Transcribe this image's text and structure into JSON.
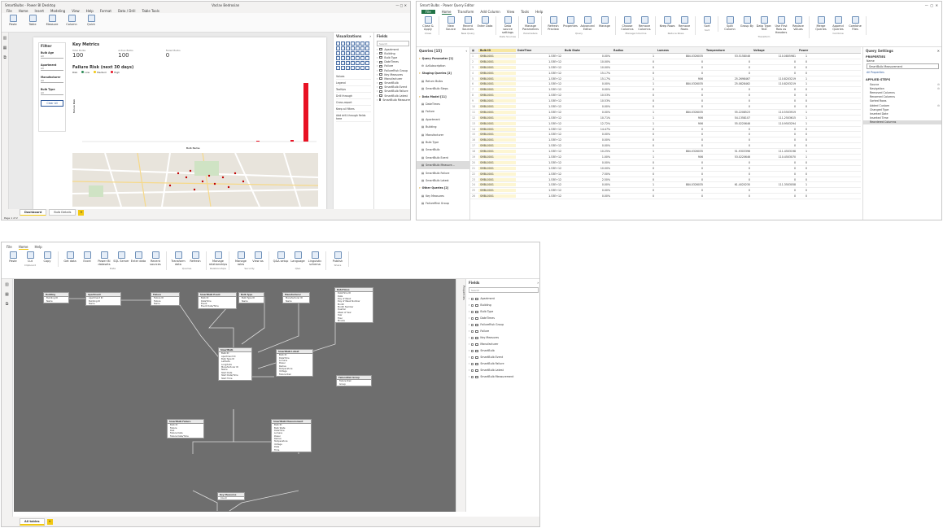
{
  "report": {
    "title": "SmartBulbs - Power BI Desktop",
    "user": "Vaclav Bedrosian",
    "menu": [
      "File",
      "Home",
      "Insert",
      "Modeling",
      "View",
      "Help",
      "Format",
      "Data / Drill",
      "Table Tools"
    ],
    "filter_pane": {
      "title": "Filter",
      "fields": [
        {
          "label": "Bulb Age",
          "value": "All"
        },
        {
          "label": "Apartment",
          "value": "All"
        },
        {
          "label": "Manufacturer",
          "value": "All"
        },
        {
          "label": "Bulb Type",
          "value": "All"
        }
      ],
      "button": "Clear All"
    },
    "card": {
      "title": "Key Metrics",
      "metrics": [
        {
          "label": "Total Bulbs",
          "value": "100"
        },
        {
          "label": "Active Bulbs",
          "value": "100"
        },
        {
          "label": "Failed Bulbs",
          "value": "0"
        }
      ]
    },
    "chart": {
      "title": "Failure Risk (next 30 days)",
      "legend": [
        "Risk",
        "Low",
        "Medium",
        "High"
      ],
      "xlabel": "Bulb Name",
      "ylabel": "Failure Risk"
    },
    "visualizations": {
      "title": "Visualizations",
      "sections": [
        "Values",
        "Legend",
        "Tooltips",
        "Drill through",
        "Cross-report",
        "Keep all filters",
        "Add drill-through fields here"
      ]
    },
    "fields": {
      "title": "Fields",
      "search": "Search",
      "items": [
        "Apartment",
        "Building",
        "Bulb Type",
        "DateTimes",
        "Failure",
        "FailureRisk Group",
        "Key Measures",
        "Manufacturer",
        "SmartBulb",
        "SmartBulb Event",
        "SmartBulb Failure",
        "SmartBulb Latest",
        "SmartBulb Measurement"
      ]
    },
    "pages": [
      "Dashboard",
      "Bulb Details"
    ],
    "status": "Page 1 of 2"
  },
  "query_editor": {
    "title": "Smart Bulbs - Power Query Editor",
    "tabs": [
      "File",
      "Home",
      "Transform",
      "Add Column",
      "View",
      "Tools",
      "Help"
    ],
    "ribbon": [
      {
        "group": "Close",
        "buttons": [
          "Close & Apply"
        ]
      },
      {
        "group": "New Query",
        "buttons": [
          "New Source",
          "Recent Sources",
          "Enter Data"
        ]
      },
      {
        "group": "Data Sources",
        "buttons": [
          "Data source settings"
        ]
      },
      {
        "group": "Parameters",
        "buttons": [
          "Manage Parameters"
        ]
      },
      {
        "group": "Query",
        "buttons": [
          "Refresh Preview",
          "Properties",
          "Advanced Editor",
          "Manage"
        ]
      },
      {
        "group": "Manage Columns",
        "buttons": [
          "Choose Columns",
          "Remove Columns"
        ]
      },
      {
        "group": "Reduce Rows",
        "buttons": [
          "Keep Rows",
          "Remove Rows"
        ]
      },
      {
        "group": "Sort",
        "buttons": [
          "Sort"
        ]
      },
      {
        "group": "Transform",
        "buttons": [
          "Split Column",
          "Group By",
          "Data Type: Text",
          "Use First Row as Headers",
          "Replace Values"
        ]
      },
      {
        "group": "Combine",
        "buttons": [
          "Merge Queries",
          "Append Queries",
          "Combine Files"
        ]
      }
    ],
    "queries_title": "Queries [15]",
    "queries": [
      {
        "name": "Query Parameter [1]",
        "kind": "folder"
      },
      {
        "name": "AzSubscription",
        "kind": "param"
      },
      {
        "name": "Staging Queries [2]",
        "kind": "folder"
      },
      {
        "name": "Return Bulbs",
        "kind": "table"
      },
      {
        "name": "SmartBulb Steps",
        "kind": "table"
      },
      {
        "name": "Data Model [11]",
        "kind": "folder"
      },
      {
        "name": "DateTimes",
        "kind": "table"
      },
      {
        "name": "Failure",
        "kind": "table"
      },
      {
        "name": "Apartment",
        "kind": "table"
      },
      {
        "name": "Building",
        "kind": "table"
      },
      {
        "name": "Manufacturer",
        "kind": "table"
      },
      {
        "name": "Bulb Type",
        "kind": "table"
      },
      {
        "name": "SmartBulb",
        "kind": "table"
      },
      {
        "name": "SmartBulb Event",
        "kind": "table"
      },
      {
        "name": "SmartBulb Measure...",
        "kind": "table",
        "selected": true
      },
      {
        "name": "SmartBulb Failure",
        "kind": "table"
      },
      {
        "name": "SmartBulb Latest",
        "kind": "table"
      },
      {
        "name": "Other Queries [2]",
        "kind": "folder"
      },
      {
        "name": "Key Measures",
        "kind": "table"
      },
      {
        "name": "FailureRisk Group",
        "kind": "table"
      }
    ],
    "columns": [
      "Bulb ID",
      "DateTime",
      "Bulb State",
      "Radius",
      "Lumens",
      "Temperature",
      "Voltage",
      "Power"
    ],
    "rows": [
      [
        "SMBL0001",
        "1.53E+12",
        "0.00%",
        "1",
        "884.0326035",
        "53.5158046",
        "110.0805981",
        "1"
      ],
      [
        "SMBL0001",
        "1.53E+12",
        "10.00%",
        "0",
        "0",
        "0",
        "0",
        "0"
      ],
      [
        "SMBL0001",
        "1.53E+12",
        "10.00%",
        "0",
        "0",
        "0",
        "0",
        "0"
      ],
      [
        "SMBL0001",
        "1.53E+12",
        "15.17%",
        "0",
        "0",
        "0",
        "0",
        "0"
      ],
      [
        "SMBL0001",
        "1.53E+12",
        "15.17%",
        "1",
        "906",
        "25.2698467",
        "110.8203219",
        "1"
      ],
      [
        "SMBL0001",
        "1.53E+12",
        "0.00%",
        "1",
        "884.0326035",
        "25.0828462",
        "110.8203219",
        "1"
      ],
      [
        "SMBL0001",
        "1.53E+12",
        "0.00%",
        "0",
        "0",
        "0",
        "0",
        "0"
      ],
      [
        "SMBL0001",
        "1.53E+12",
        "10.53%",
        "0",
        "0",
        "0",
        "0",
        "0"
      ],
      [
        "SMBL0001",
        "1.53E+12",
        "10.53%",
        "0",
        "0",
        "0",
        "0",
        "0"
      ],
      [
        "SMBL0001",
        "1.53E+12",
        "0.00%",
        "0",
        "0",
        "0",
        "0",
        "0"
      ],
      [
        "SMBL0001",
        "1.53E+12",
        "0.00%",
        "1",
        "884.0326035",
        "55.2208523",
        "110.5503919",
        "1"
      ],
      [
        "SMBL0001",
        "1.53E+12",
        "10.71%",
        "1",
        "906",
        "54.1358107",
        "111.2503615",
        "1"
      ],
      [
        "SMBL0001",
        "1.53E+12",
        "12.72%",
        "1",
        "906",
        "55.0220646",
        "110.9503294",
        "1"
      ],
      [
        "SMBL0001",
        "1.53E+12",
        "14.47%",
        "0",
        "0",
        "0",
        "0",
        "0"
      ],
      [
        "SMBL0001",
        "1.53E+12",
        "0.00%",
        "0",
        "0",
        "0",
        "0",
        "0"
      ],
      [
        "SMBL0001",
        "1.53E+12",
        "0.00%",
        "0",
        "0",
        "0",
        "0",
        "0"
      ],
      [
        "SMBL0001",
        "1.53E+12",
        "0.00%",
        "0",
        "0",
        "0",
        "0",
        "0"
      ],
      [
        "SMBL0001",
        "1.53E+12",
        "10.25%",
        "1",
        "884.0326035",
        "51.9303396",
        "111.4503198",
        "1"
      ],
      [
        "SMBL0001",
        "1.53E+12",
        "1.00%",
        "1",
        "906",
        "53.0220646",
        "110.4503070",
        "1"
      ],
      [
        "SMBL0001",
        "1.53E+12",
        "0.00%",
        "0",
        "0",
        "0",
        "0",
        "0"
      ],
      [
        "SMBL0001",
        "1.53E+12",
        "10.00%",
        "0",
        "0",
        "0",
        "0",
        "0"
      ],
      [
        "SMBL0001",
        "1.53E+12",
        "7.50%",
        "0",
        "0",
        "0",
        "0",
        "0"
      ],
      [
        "SMBL0001",
        "1.53E+12",
        "2.50%",
        "0",
        "0",
        "0",
        "0",
        "0"
      ],
      [
        "SMBL0001",
        "1.53E+12",
        "0.00%",
        "1",
        "884.0326035",
        "61.4020230",
        "111.3503058",
        "1"
      ],
      [
        "SMBL0001",
        "1.53E+12",
        "0.00%",
        "0",
        "0",
        "0",
        "0",
        "0"
      ],
      [
        "SMBL0001",
        "1.53E+12",
        "0.00%",
        "0",
        "0",
        "0",
        "0",
        "0"
      ]
    ],
    "settings": {
      "title": "Query Settings",
      "properties": "PROPERTIES",
      "name_label": "Name",
      "name_value": "SmartBulb Measurement",
      "all_properties": "All Properties",
      "applied_steps": "APPLIED STEPS",
      "steps": [
        "Source",
        "Navigation",
        "Removed Columns",
        "Renamed Columns",
        "Sorted Rows",
        "Added Custom",
        "Changed Type",
        "Inserted Date",
        "Inserted Time",
        "Reordered Columns"
      ]
    }
  },
  "model_view": {
    "tabs": [
      "File",
      "Home",
      "Help"
    ],
    "ribbon": [
      {
        "group": "Clipboard",
        "buttons": [
          "Paste",
          "Cut",
          "Copy"
        ]
      },
      {
        "group": "Data",
        "buttons": [
          "Get data",
          "Excel",
          "Power BI datasets",
          "SQL Server",
          "Enter data",
          "Recent sources"
        ]
      },
      {
        "group": "Queries",
        "buttons": [
          "Transform data",
          "Refresh"
        ]
      },
      {
        "group": "Relationships",
        "buttons": [
          "Manage relationships"
        ]
      },
      {
        "group": "Security",
        "buttons": [
          "Manage roles",
          "View as"
        ]
      },
      {
        "group": "Q&A",
        "buttons": [
          "Q&A setup",
          "Language",
          "Linguistic schema"
        ]
      },
      {
        "group": "Share",
        "buttons": [
          "Publish"
        ]
      }
    ],
    "tables": [
      {
        "name": "Building",
        "fields": [
          "Building ID",
          "Name"
        ]
      },
      {
        "name": "Apartment",
        "fields": [
          "Apartment ID",
          "Building ID",
          "Name"
        ]
      },
      {
        "name": "Failure",
        "fields": [
          "Failure ID",
          "Failure",
          "Name"
        ]
      },
      {
        "name": "SmartBulb Event",
        "fields": [
          "Bulb ID",
          "DateTime",
          "Event",
          "Event Date/Time"
        ]
      },
      {
        "name": "Bulb Type",
        "fields": [
          "Bulb Type ID",
          "Name"
        ]
      },
      {
        "name": "Manufacturer",
        "fields": [
          "Manufacturer ID",
          "Name"
        ]
      },
      {
        "name": "DateTimes",
        "fields": [
          "DateTime ID",
          "Date",
          "Day of Week",
          "Day of Week Number",
          "Month",
          "Month Number",
          "Quarter",
          "Week of Year",
          "Year",
          "Hour",
          "Minute"
        ]
      },
      {
        "name": "SmartBulb",
        "fields": [
          "Bulb ID",
          "Apartment ID",
          "Bulb Type ID",
          "Latitude",
          "Longitude",
          "Manufacturer ID",
          "Name",
          "Start Date",
          "Start Date/Time",
          "Start Time"
        ]
      },
      {
        "name": "SmartBulb Latest",
        "fields": [
          "Bulb ID",
          "DateTime",
          "Lumens",
          "Power",
          "Radius",
          "Temperature",
          "Voltage",
          "Failure Risk"
        ]
      },
      {
        "name": "FailureRisk Group",
        "fields": [
          "Failure Risk",
          "Group"
        ]
      },
      {
        "name": "SmartBulb Failure",
        "fields": [
          "Bulb ID",
          "Failure",
          "Risk",
          "Failure Date",
          "Failure Date/Time"
        ]
      },
      {
        "name": "SmartBulb Measurement",
        "fields": [
          "Bulb ID",
          "Bulb State",
          "DateTime",
          "Lumens",
          "Power",
          "Radius",
          "Temperature",
          "Voltage",
          "Date",
          "Time"
        ]
      },
      {
        "name": "Key Measures",
        "fields": [
          "Count"
        ]
      }
    ],
    "properties_label": "Properties",
    "fields_panel": {
      "title": "Fields",
      "search": "Search",
      "items": [
        "Apartment",
        "Building",
        "Bulb Type",
        "DateTimes",
        "FailureRisk Group",
        "Failure",
        "Key Measures",
        "Manufacturer",
        "SmartBulb",
        "SmartBulb Event",
        "SmartBulb Failure",
        "SmartBulb Latest",
        "SmartBulb Measurement"
      ]
    },
    "pages": [
      "All tables"
    ]
  },
  "colors": {
    "accent": "#f2c811",
    "pq_green": "#217346",
    "bar_red": "#e81123",
    "bulb_ribbon_blue": "#2b579a"
  }
}
